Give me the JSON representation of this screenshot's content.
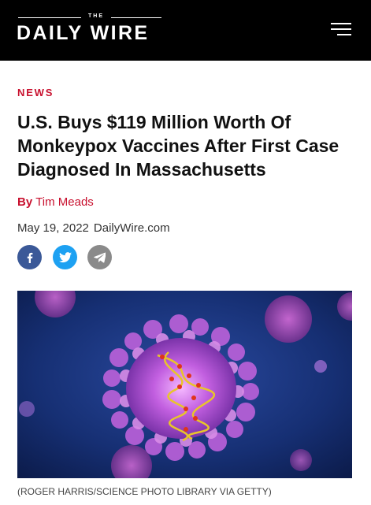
{
  "header": {
    "logo_the": "THE",
    "logo_text": "DAILY WIRE",
    "menu_icon": "hamburger-menu-icon",
    "background": "#000000"
  },
  "article": {
    "section": "NEWS",
    "headline": "U.S. Buys $119 Million Worth Of Monkeypox Vaccines After First Case Diagnosed In Massachusetts",
    "byline_prefix": "By",
    "author": "Tim Meads",
    "date": "May 19, 2022",
    "source": "DailyWire.com",
    "accent_color": "#c8102e"
  },
  "share": [
    {
      "name": "facebook",
      "icon": "facebook-icon",
      "color": "#3b5998"
    },
    {
      "name": "twitter",
      "icon": "twitter-icon",
      "color": "#1da1f2"
    },
    {
      "name": "telegram",
      "icon": "telegram-icon",
      "color": "#8a8a8a"
    }
  ],
  "image": {
    "caption": "(ROGER HARRIS/SCIENCE PHOTO LIBRARY VIA GETTY)"
  }
}
